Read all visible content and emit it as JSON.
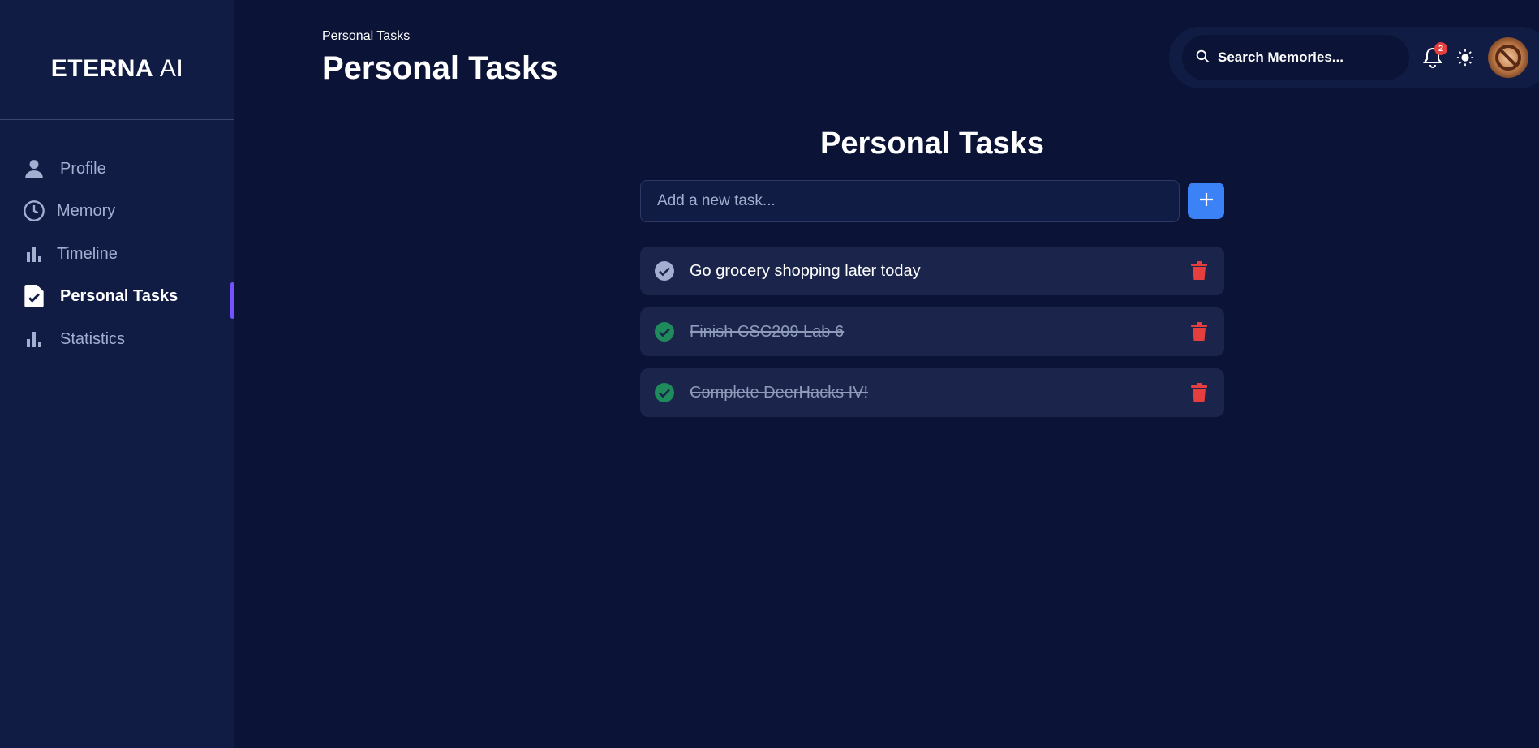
{
  "sidebar": {
    "brand": {
      "name": "ETERNA",
      "suffix": "AI"
    },
    "items": [
      {
        "label": "Profile",
        "icon": "person-icon"
      },
      {
        "label": "Memory",
        "icon": "clock-icon"
      },
      {
        "label": "Timeline",
        "icon": "bar-chart-icon"
      },
      {
        "label": "Personal Tasks",
        "icon": "task-file-icon",
        "active": true
      },
      {
        "label": "Statistics",
        "icon": "bar-chart-icon"
      }
    ]
  },
  "header": {
    "breadcrumb": "Personal Tasks",
    "title": "Personal Tasks",
    "search": {
      "placeholder": "Search Memories..."
    },
    "notifications": {
      "count": "2"
    }
  },
  "main": {
    "title": "Personal Tasks",
    "new_task": {
      "placeholder": "Add a new task..."
    },
    "tasks": [
      {
        "text": "Go grocery shopping later today",
        "done": false
      },
      {
        "text": "Finish CSC209 Lab 6",
        "done": true
      },
      {
        "text": "Complete DeerHacks IV!",
        "done": true
      }
    ]
  },
  "colors": {
    "background": "#0b1437",
    "sidebar": "#111c44",
    "accent_blue": "#3b82f6",
    "active_indicator": "#7551ff",
    "done_green": "#1f8a5b",
    "delete_red": "#e53e3e"
  }
}
